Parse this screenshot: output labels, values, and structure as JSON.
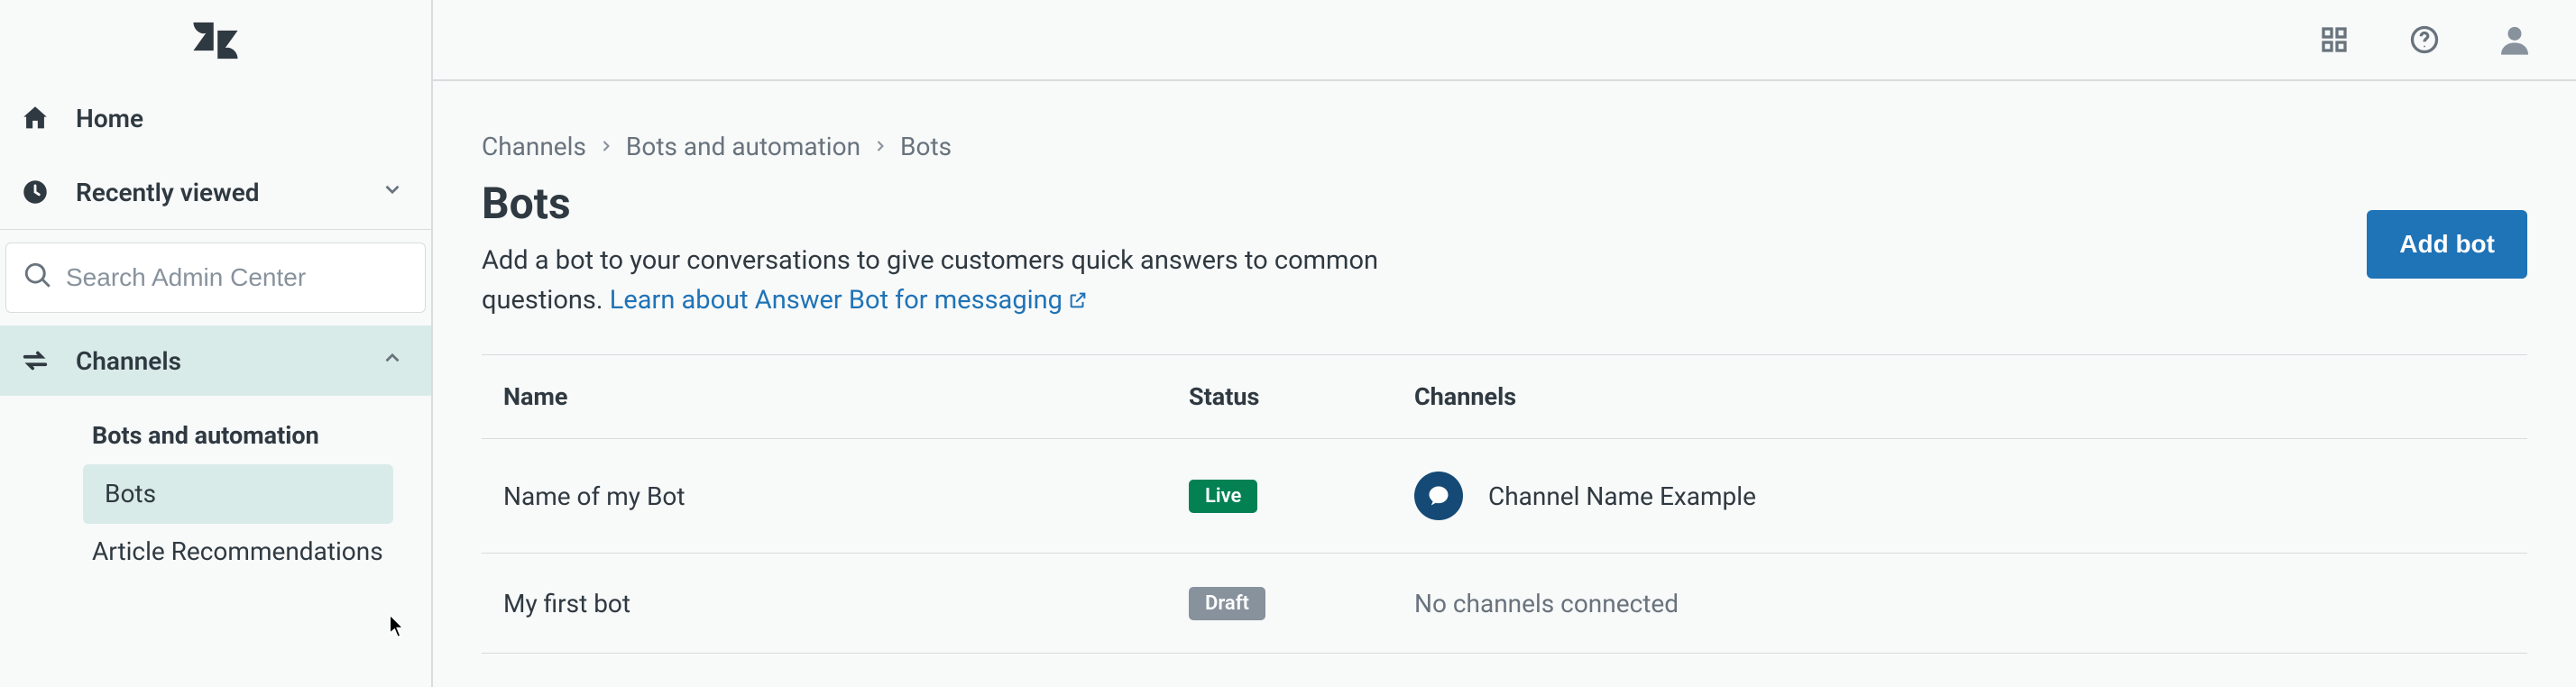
{
  "sidebar": {
    "home": "Home",
    "recently_viewed": "Recently viewed",
    "search_placeholder": "Search Admin Center",
    "section_channels": "Channels",
    "group_bots_auto": "Bots and automation",
    "item_bots": "Bots",
    "item_article_reco": "Article Recommendations"
  },
  "breadcrumb": {
    "c0": "Channels",
    "c1": "Bots and automation",
    "c2": "Bots"
  },
  "page": {
    "title": "Bots",
    "desc_prefix": "Add a bot to your conversations to give customers quick answers to common questions. ",
    "link_text": "Learn about Answer Bot for messaging"
  },
  "buttons": {
    "add_bot": "Add bot"
  },
  "table": {
    "col_name": "Name",
    "col_status": "Status",
    "col_channels": "Channels",
    "rows": [
      {
        "name": "Name of my Bot",
        "status": "Live",
        "status_class": "live",
        "channel": "Channel Name Example"
      },
      {
        "name": "My first bot",
        "status": "Draft",
        "status_class": "draft",
        "channel_none": "No channels connected"
      }
    ]
  }
}
